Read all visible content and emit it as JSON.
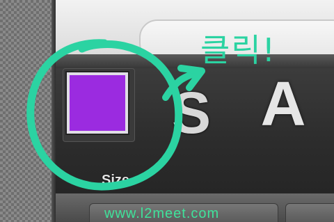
{
  "toolbar": {
    "color_swatch_color": "#9b2be0",
    "tool_s_label": "S",
    "tool_a_label": "A",
    "swatch_label": "Size"
  },
  "footer": {
    "url_text": "www.l2meet.com"
  },
  "annotation": {
    "text": "클릭!",
    "color": "#2bd3a2"
  }
}
